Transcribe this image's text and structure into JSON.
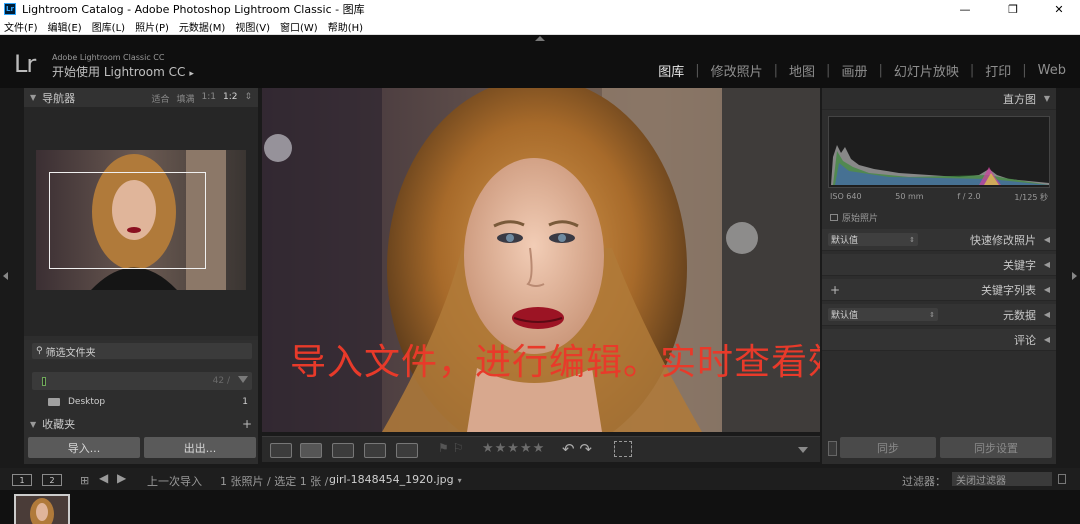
{
  "window": {
    "title": "Lightroom Catalog - Adobe Photoshop Lightroom Classic - 图库",
    "app_icon_label": "Lr",
    "minimize": "—",
    "maximize": "❐",
    "close": "✕"
  },
  "menu": {
    "items": [
      "文件(F)",
      "编辑(E)",
      "图库(L)",
      "照片(P)",
      "元数据(M)",
      "视图(V)",
      "窗口(W)",
      "帮助(H)"
    ]
  },
  "identity": {
    "logo": "Lr",
    "small_text": "Adobe Lightroom Classic CC",
    "main_text": "开始使用 Lightroom CC",
    "main_arrow": "▸"
  },
  "modules": {
    "items": [
      "图库",
      "修改照片",
      "地图",
      "画册",
      "幻灯片放映",
      "打印",
      "Web"
    ],
    "separator": "|",
    "active_index": 0
  },
  "left_panel": {
    "navigator": {
      "title": "导航器",
      "options": [
        "适合",
        "填满",
        "1:1",
        "1:2"
      ],
      "selected": "1:2",
      "spinner": "⇕"
    },
    "filter_folders": {
      "label": "筛选文件夹"
    },
    "folder_row": {
      "count": "42 / ",
      "dropdown": "▾"
    },
    "desktop": {
      "label": "Desktop",
      "count": "1"
    },
    "collections": {
      "title": "收藏夹",
      "add": "+"
    },
    "import_label": "导入...",
    "export_label": "出出..."
  },
  "main": {
    "overlay_text": "导入文件，进行编辑。实时查看效果"
  },
  "toolbar": {
    "stars": "★★★★★",
    "rotate": "↶ ↷",
    "dropdown": "▾"
  },
  "right_panel": {
    "histogram": {
      "title": "直方图",
      "iso": "ISO 640",
      "focal": "50 mm",
      "aperture": "f / 2.0",
      "shutter": "1/125 秒",
      "original_photo": "原始照片"
    },
    "quick_develop": {
      "preset": "默认值",
      "title": "快速修改照片"
    },
    "keywording": {
      "title": "关键字"
    },
    "keyword_list": {
      "add": "+",
      "title": "关键字列表"
    },
    "metadata": {
      "preset": "默认值",
      "title": "元数据"
    },
    "comments": {
      "title": "评论"
    },
    "collapse_arrow": "◀",
    "sync_label": "同步",
    "sync_settings_label": "同步设置"
  },
  "filmbar": {
    "screen1": "1",
    "screen2": "2",
    "grid": "⊞",
    "back": "◀",
    "forward": "▶",
    "source": "上一次导入",
    "count": "1 张照片 / 选定 1 张 /",
    "file": "girl-1848454_1920.jpg",
    "file_arrow": "▾",
    "filter_label": "过滤器：",
    "filter_value": "关闭过滤器"
  }
}
